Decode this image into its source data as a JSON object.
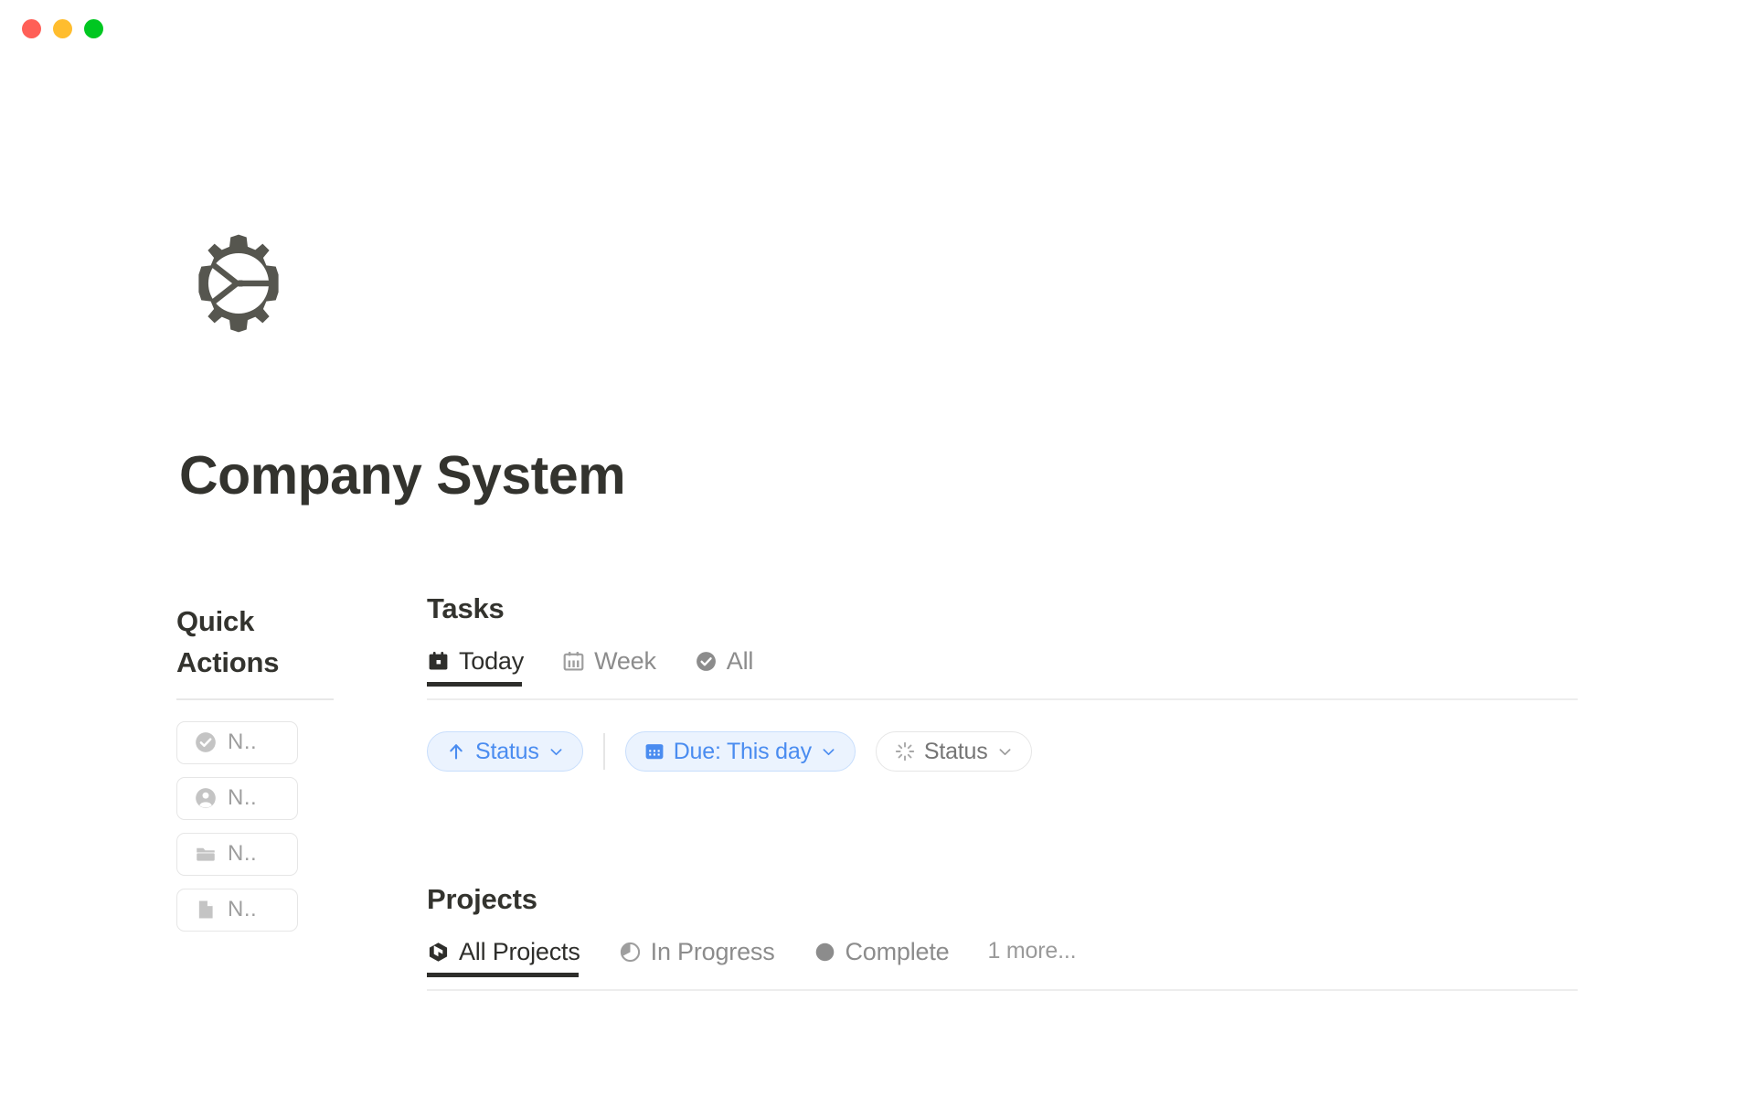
{
  "window": {
    "traffic_lights": [
      {
        "name": "close",
        "color": "#FF5F57"
      },
      {
        "name": "minimize",
        "color": "#FFBD2E"
      },
      {
        "name": "zoom",
        "color": "#00C721"
      }
    ]
  },
  "header": {
    "logo_icon": "gear-icon",
    "title": "Company System"
  },
  "quick_actions": {
    "title": "Quick Actions",
    "items": [
      {
        "icon": "check-circle-icon",
        "label": "N.."
      },
      {
        "icon": "person-circle-icon",
        "label": "N.."
      },
      {
        "icon": "folder-icon",
        "label": "N.."
      },
      {
        "icon": "document-icon",
        "label": "N.."
      }
    ]
  },
  "tasks": {
    "title": "Tasks",
    "tabs": [
      {
        "label": "Today",
        "icon": "calendar-day-icon",
        "active": true
      },
      {
        "label": "Week",
        "icon": "calendar-week-icon",
        "active": false
      },
      {
        "label": "All",
        "icon": "check-circle-icon",
        "active": false
      }
    ],
    "filters": [
      {
        "icon": "arrow-up-icon",
        "label": "Status",
        "chevron": "chevron-down-icon",
        "style": "blue"
      },
      {
        "icon": "calendar-grid-icon",
        "label": "Due: This day",
        "chevron": "chevron-down-icon",
        "style": "blue"
      },
      {
        "icon": "spinner-icon",
        "label": "Status",
        "chevron": "chevron-down-icon",
        "style": "gray"
      }
    ]
  },
  "projects": {
    "title": "Projects",
    "tabs": [
      {
        "label": "All Projects",
        "icon": "cube-icon",
        "active": true
      },
      {
        "label": "In Progress",
        "icon": "pie-quarter-icon",
        "active": false
      },
      {
        "label": "Complete",
        "icon": "filled-circle-icon",
        "active": false
      },
      {
        "label": "1 more...",
        "icon": "",
        "active": false
      }
    ]
  },
  "colors": {
    "accent_blue": "#4A8CF0",
    "pill_blue_bg": "#EBF3FE",
    "pill_blue_border": "#C8DEFC",
    "text_dark": "#33332E",
    "text_muted": "#8C8C8C",
    "border_light": "#E6E6E6"
  }
}
